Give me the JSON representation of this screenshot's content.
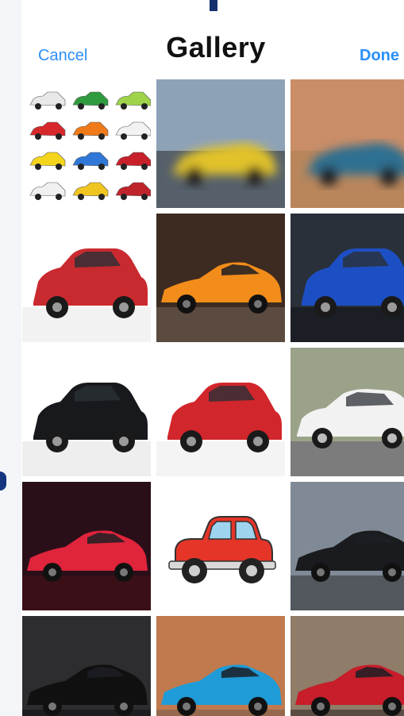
{
  "header": {
    "cancel_label": "Cancel",
    "title": "Gallery",
    "done_label": "Done"
  },
  "accent_color": "#2a8ff7",
  "photos": [
    {
      "name": "car-collection-thumbnail",
      "kind": "multi-car",
      "colors": [
        "#e8e8e8",
        "#2f9b3f",
        "#9ed34a",
        "#d7282c",
        "#f07a18",
        "#f2f2f2",
        "#f4d51c",
        "#2f78d8",
        "#c7202a",
        "#f0f0f0",
        "#f0c520",
        "#c0242b"
      ]
    },
    {
      "name": "yellow-sports-car-photo",
      "kind": "blur",
      "bg": "#8ea2b7",
      "ground": "#56606a",
      "car": "#e1c22c"
    },
    {
      "name": "blue-sports-car-desert-photo",
      "kind": "blur",
      "bg": "#c98d67",
      "ground": "#b9865c",
      "car": "#2f6f91"
    },
    {
      "name": "red-suv-photo",
      "kind": "suv",
      "bg": "#ffffff",
      "ground": "#f2f2f2",
      "car": "#c92a2f"
    },
    {
      "name": "orange-supercar-forest-photo",
      "kind": "sports",
      "bg": "#3d2a20",
      "ground": "#5b4a3f",
      "car": "#f28c1a"
    },
    {
      "name": "blue-suv-photo",
      "kind": "suv",
      "bg": "#29303a",
      "ground": "#1b1f25",
      "car": "#1d4fc4"
    },
    {
      "name": "black-suv-photo",
      "kind": "suv",
      "bg": "#ffffff",
      "ground": "#eeeeee",
      "car": "#18191c"
    },
    {
      "name": "red-compact-suv-photo",
      "kind": "suv",
      "bg": "#ffffff",
      "ground": "#f4f4f4",
      "car": "#d1262b"
    },
    {
      "name": "white-sports-sedan-photo",
      "kind": "sedan",
      "bg": "#9aa289",
      "ground": "#7c7c7c",
      "car": "#f2f2f2"
    },
    {
      "name": "red-corvette-photo",
      "kind": "sports",
      "bg": "#2a0f18",
      "ground": "#3a0f18",
      "car": "#e0243b"
    },
    {
      "name": "red-cartoon-car-illustration",
      "kind": "cartoon",
      "bg": "#ffffff",
      "ground": "#ffffff",
      "car": "#e43528"
    },
    {
      "name": "black-mustang-photo",
      "kind": "sports",
      "bg": "#7f8a96",
      "ground": "#52585e",
      "car": "#1a1b1e"
    },
    {
      "name": "black-supercar-showroom-photo",
      "kind": "sports",
      "bg": "#2d2d2f",
      "ground": "#1d1d1f",
      "car": "#101010"
    },
    {
      "name": "blue-camaro-photo",
      "kind": "sports",
      "bg": "#c07a4d",
      "ground": "#95694d",
      "car": "#1f9bd8"
    },
    {
      "name": "red-sports-car-street-photo",
      "kind": "sports",
      "bg": "#8f7c69",
      "ground": "#5a4c43",
      "car": "#c81d2a"
    }
  ]
}
